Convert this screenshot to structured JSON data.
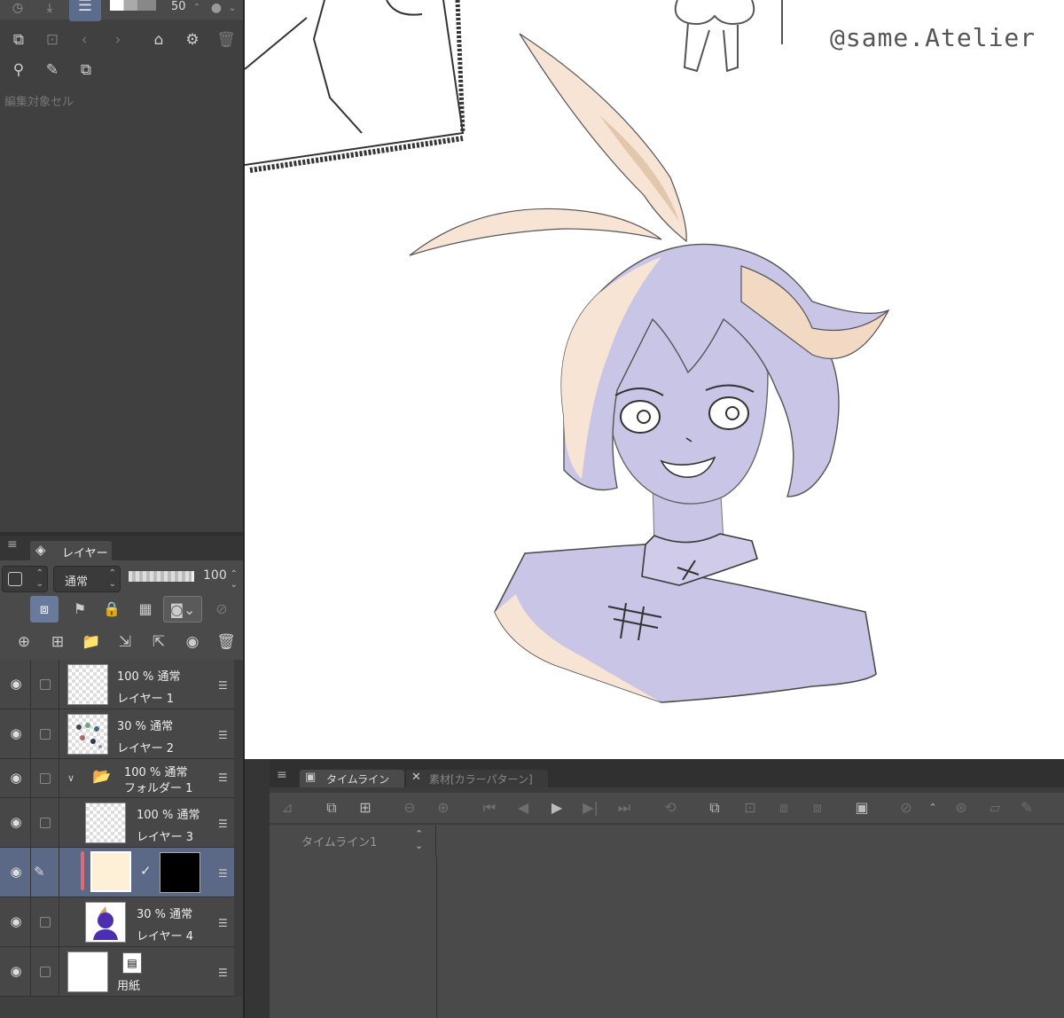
{
  "top_toolbar": {
    "brush_size_value": "50",
    "icons": [
      "timer-icon",
      "move-down-icon",
      "layer-stack-icon",
      "color-swatch",
      "circles-icon"
    ]
  },
  "edit_cell_panel": {
    "label": "編集対象セル"
  },
  "layer_panel": {
    "tab_label": "レイヤー",
    "blend_mode": "通常",
    "opacity": "100",
    "layers": [
      {
        "opacity": "100 %",
        "mode": "通常",
        "name": "レイヤー 1"
      },
      {
        "opacity": "30 %",
        "mode": "通常",
        "name": "レイヤー 2"
      },
      {
        "opacity": "100 %",
        "mode": "通常",
        "name": "フォルダー 1"
      },
      {
        "opacity": "100 %",
        "mode": "通常",
        "name": "レイヤー 3"
      },
      {
        "opacity": "",
        "mode": "",
        "name": ""
      },
      {
        "opacity": "30 %",
        "mode": "通常",
        "name": "レイヤー 4"
      },
      {
        "opacity": "",
        "mode": "",
        "name": "用紙"
      }
    ]
  },
  "canvas": {
    "watermark": "@same.Atelier",
    "colors": {
      "skin_shadow": "#c9c5e6",
      "hair": "#f7e4d4",
      "hair_shade": "#e3c7ad",
      "line": "#555555"
    }
  },
  "timeline": {
    "tab_label": "タイムライン",
    "materials_tab_label": "素材[カラーパターン]",
    "timeline_name": "タイムライン1"
  },
  "colors": {
    "panel_bg": "#404040",
    "selected_layer": "#5b6886",
    "accent_active": "#5c6c8c",
    "layer_color_tag": "#e06a78"
  }
}
